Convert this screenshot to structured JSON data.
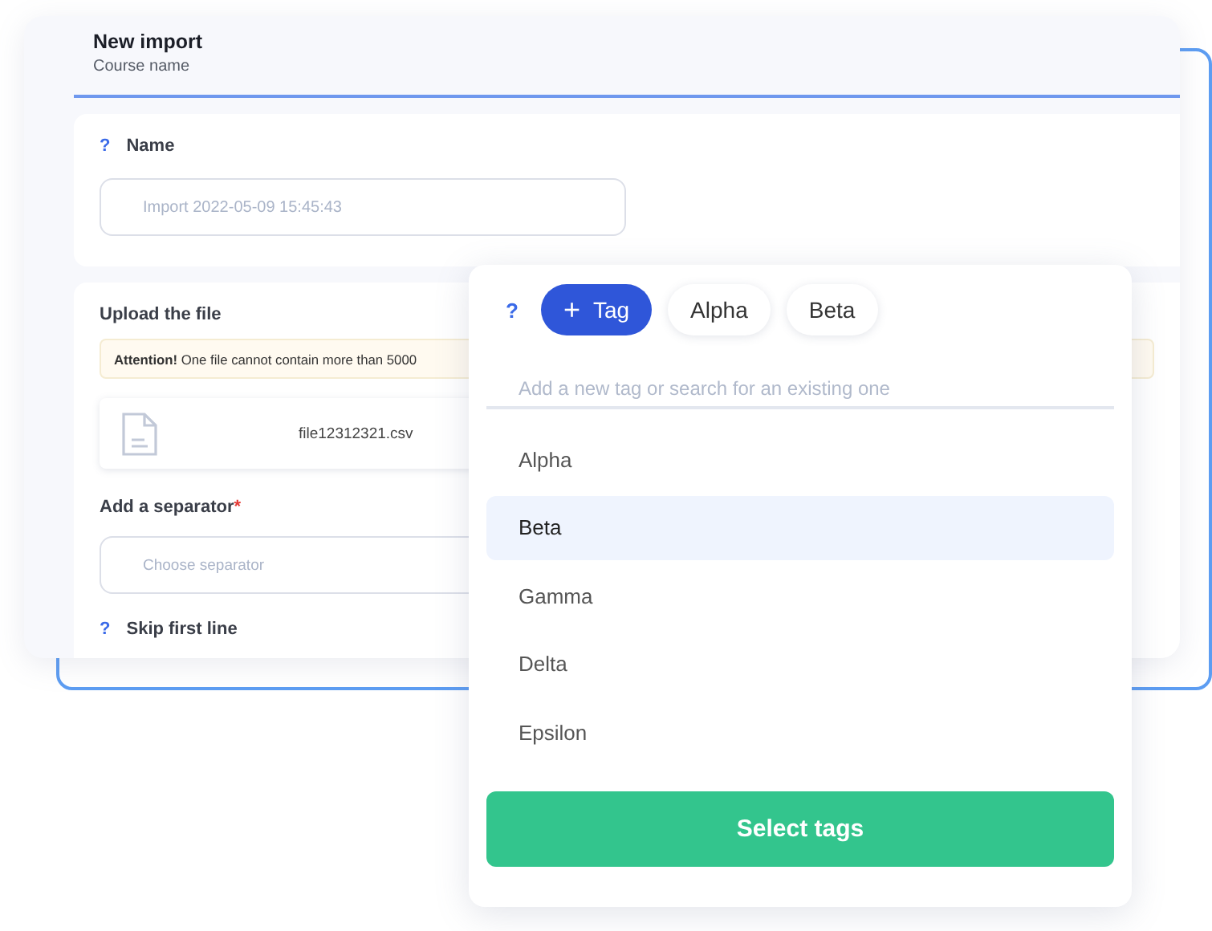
{
  "window": {
    "title": "New import",
    "subtitle": "Course name"
  },
  "name_section": {
    "help": "?",
    "label": "Name",
    "placeholder": "Import 2022-05-09 15:45:43"
  },
  "upload_section": {
    "title": "Upload the file",
    "notice": "**Attention!** One file cannot contain more than 5000",
    "file_name": "file12312321.csv",
    "separator_label": "Add a separator",
    "required_mark": "*",
    "separator_placeholder": "Choose separator",
    "skip_help": "?",
    "skip_label": "Skip first line"
  },
  "tag_popup": {
    "help": "?",
    "add_icon": "+",
    "add_label": "Tag",
    "chips": [
      {
        "label": "Alpha"
      },
      {
        "label": "Beta"
      }
    ],
    "search_placeholder": "Add a new tag or search for an existing one",
    "options": [
      {
        "label": "Alpha",
        "selected": false
      },
      {
        "label": "Beta",
        "selected": true
      },
      {
        "label": "Gamma",
        "selected": false
      },
      {
        "label": "Delta",
        "selected": false
      },
      {
        "label": "Epsilon",
        "selected": false
      }
    ],
    "submit": "Select tags"
  }
}
